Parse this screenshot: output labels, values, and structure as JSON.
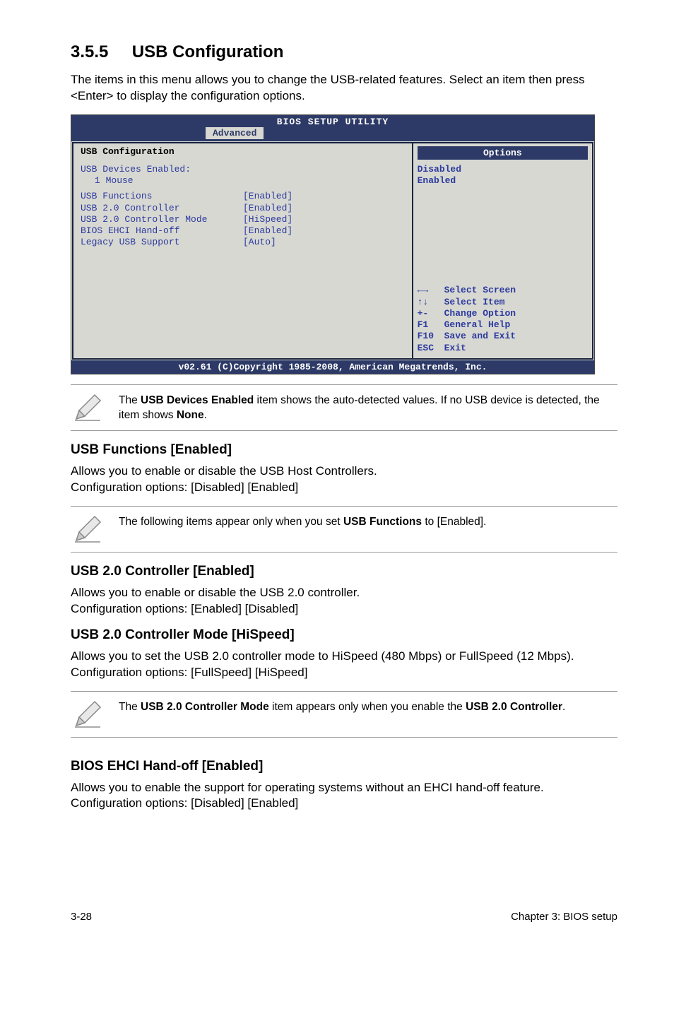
{
  "section": {
    "number": "3.5.5",
    "title": "USB Configuration"
  },
  "intro": "The items in this menu allows you to change the USB-related features. Select an item then press <Enter> to display the configuration options.",
  "bios": {
    "title": "BIOS SETUP UTILITY",
    "tab": "Advanced",
    "left_title": "USB Configuration",
    "devices_label": "USB Devices Enabled:",
    "devices_value": "1 Mouse",
    "rows": [
      {
        "label": "USB Functions",
        "value": "[Enabled]"
      },
      {
        "label": "USB 2.0 Controller",
        "value": "[Enabled]"
      },
      {
        "label": "USB 2.0 Controller Mode",
        "value": "[HiSpeed]"
      },
      {
        "label": "BIOS EHCI Hand-off",
        "value": "[Enabled]"
      },
      {
        "label": "Legacy USB Support",
        "value": "[Auto]"
      }
    ],
    "options_header": "Options",
    "options": [
      "Disabled",
      "Enabled"
    ],
    "nav": [
      {
        "key": "←→",
        "label": "Select Screen"
      },
      {
        "key": "↑↓",
        "label": "Select Item"
      },
      {
        "key": "+-",
        "label": "Change Option"
      },
      {
        "key": "F1",
        "label": "General Help"
      },
      {
        "key": "F10",
        "label": "Save and Exit"
      },
      {
        "key": "ESC",
        "label": "Exit"
      }
    ],
    "footer": "v02.61 (C)Copyright 1985-2008, American Megatrends, Inc."
  },
  "note1_a": "The ",
  "note1_b": "USB Devices Enabled",
  "note1_c": " item shows the auto-detected values. If no USB device is detected, the item shows ",
  "note1_d": "None",
  "note1_e": ".",
  "usb_functions": {
    "title": "USB Functions [Enabled]",
    "line1": "Allows you to enable or disable the USB Host Controllers.",
    "line2": "Configuration options: [Disabled] [Enabled]"
  },
  "note2_a": "The following items appear only when you set ",
  "note2_b": "USB Functions",
  "note2_c": " to [Enabled].",
  "usb20": {
    "title": "USB 2.0 Controller [Enabled]",
    "line1": "Allows you to enable or disable the USB 2.0 controller.",
    "line2": "Configuration options: [Enabled] [Disabled]"
  },
  "usb20mode": {
    "title": "USB 2.0 Controller Mode [HiSpeed]",
    "line1": "Allows you to set the USB 2.0 controller mode to HiSpeed (480 Mbps) or FullSpeed (12 Mbps).",
    "line2": "Configuration options: [FullSpeed] [HiSpeed]"
  },
  "note3_a": "The ",
  "note3_b": "USB 2.0 Controller Mode",
  "note3_c": " item appears only when you enable the ",
  "note3_d": "USB 2.0 Controller",
  "note3_e": ".",
  "ehci": {
    "title": "BIOS EHCI Hand-off [Enabled]",
    "line1": "Allows you to enable the support for operating systems without an EHCI hand-off feature.",
    "line2": "Configuration options: [Disabled] [Enabled]"
  },
  "footer": {
    "left": "3-28",
    "right": "Chapter 3: BIOS setup"
  }
}
